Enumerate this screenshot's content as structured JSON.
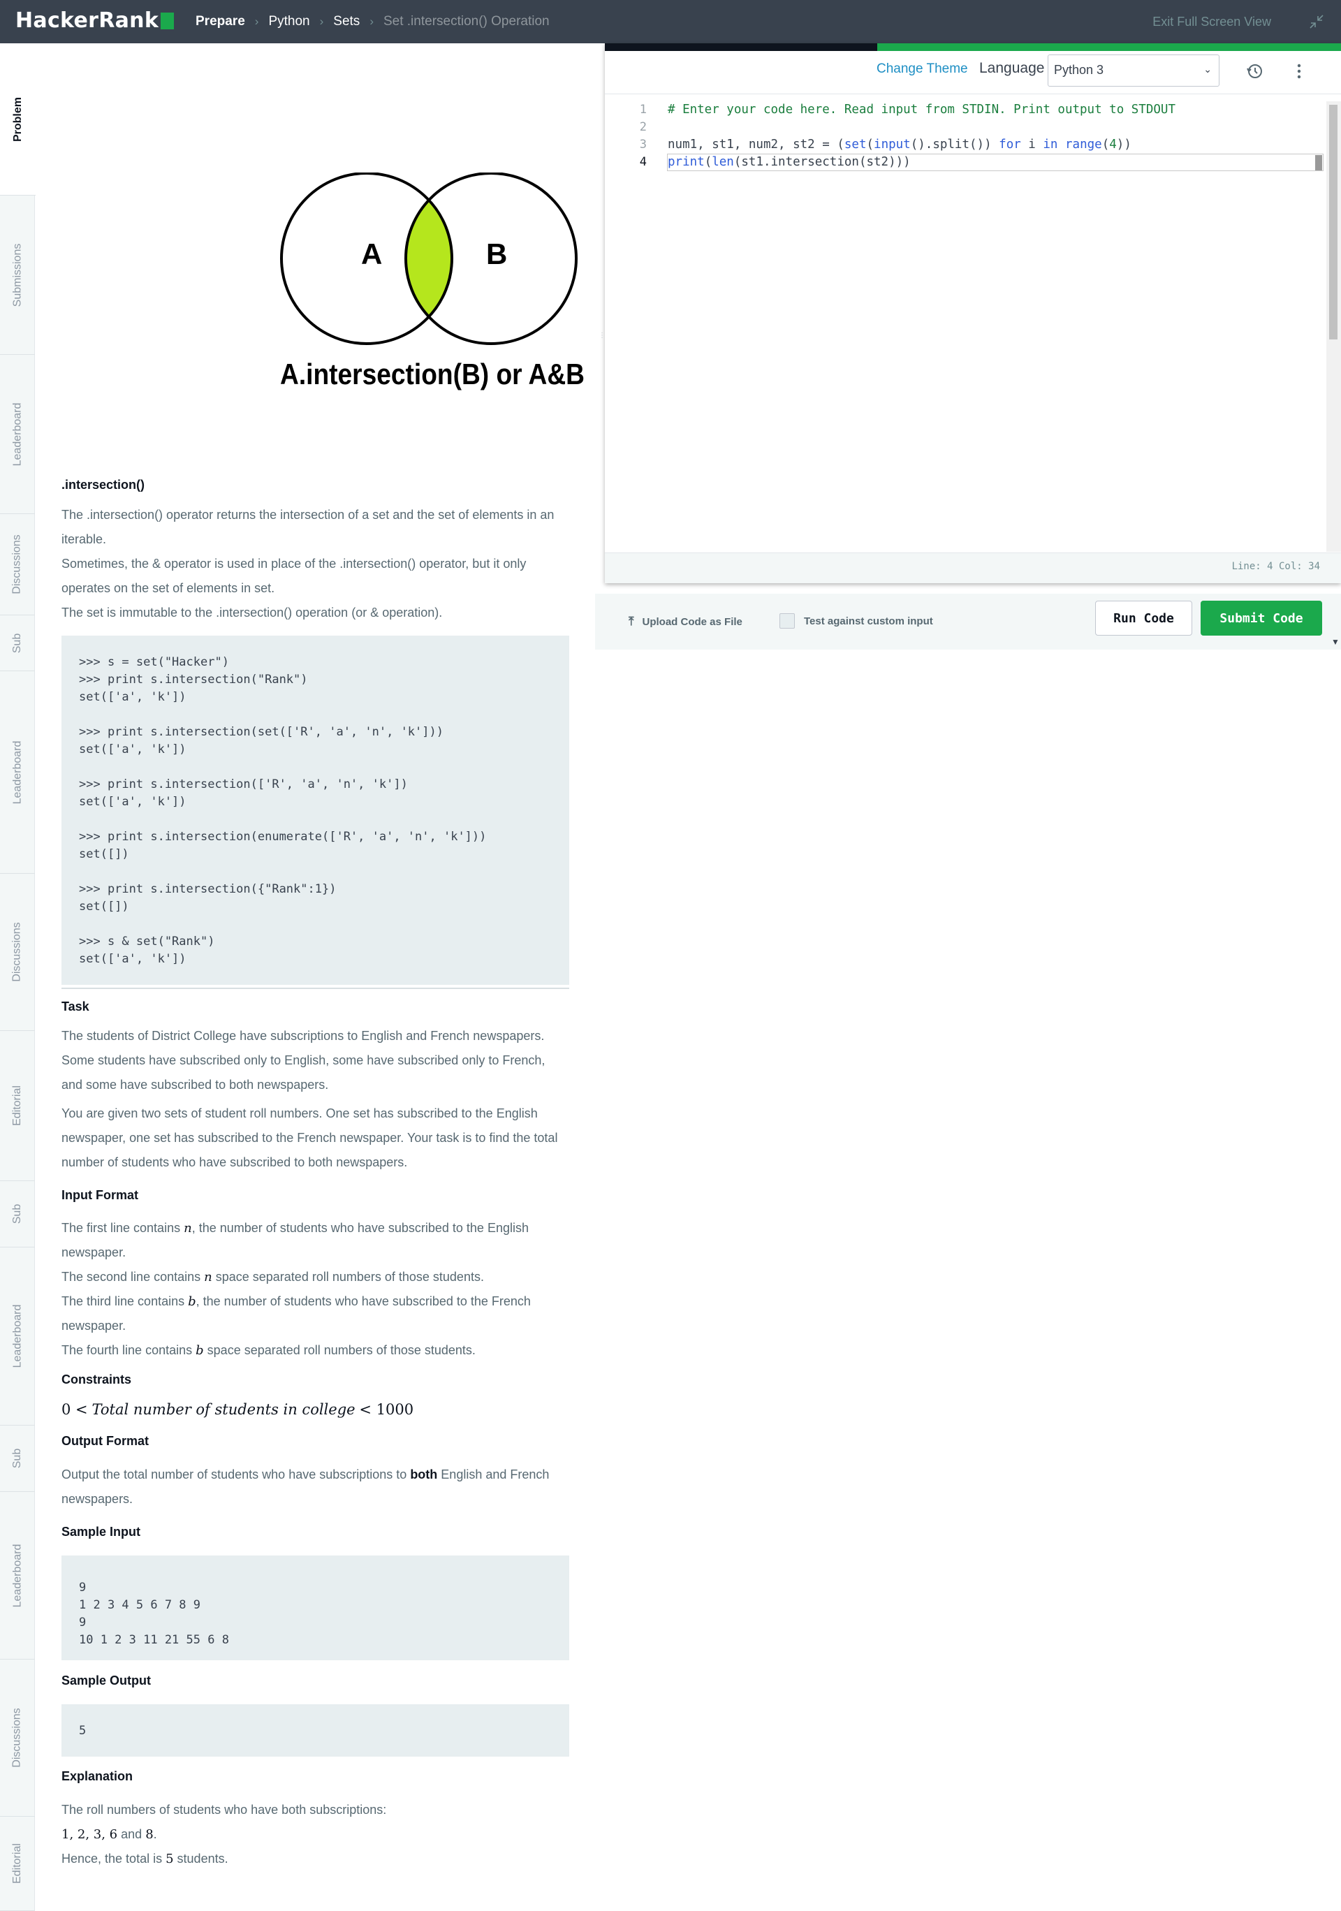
{
  "header": {
    "logo_text": "HackerRank",
    "breadcrumbs": [
      "Prepare",
      "Python",
      "Sets",
      "Set .intersection() Operation"
    ],
    "exit_fullscreen": "Exit Full Screen View"
  },
  "sidebar_tabs": [
    {
      "label": "Problem",
      "active": true
    },
    {
      "label": "Submissions"
    },
    {
      "label": "Leaderboard"
    },
    {
      "label": "Discussions"
    },
    {
      "label": "Sub"
    },
    {
      "label": "Leaderboard"
    },
    {
      "label": "Discussions"
    },
    {
      "label": "Editorial"
    },
    {
      "label": "Sub"
    },
    {
      "label": "Leaderboard"
    },
    {
      "label": "Sub"
    },
    {
      "label": "Leaderboard"
    },
    {
      "label": "Discussions"
    },
    {
      "label": "Editorial"
    }
  ],
  "venn": {
    "label_a": "A",
    "label_b": "B",
    "caption": "A.intersection(B) or A&B",
    "highlight_color": "#b5e61d"
  },
  "problem": {
    "section_title": ".intersection()",
    "intro_1": "The .intersection() operator returns the intersection of a set and the set of elements in an",
    "intro_1b": "iterable.",
    "intro_2": "Sometimes, the & operator is used in place of the .intersection() operator, but it only",
    "intro_2b": "operates on the set of elements in set.",
    "intro_3": "The set is immutable to the .intersection() operation (or & operation).",
    "example_code": ">>> s = set(\"Hacker\")\n>>> print s.intersection(\"Rank\")\nset(['a', 'k'])\n\n>>> print s.intersection(set(['R', 'a', 'n', 'k']))\nset(['a', 'k'])\n\n>>> print s.intersection(['R', 'a', 'n', 'k'])\nset(['a', 'k'])\n\n>>> print s.intersection(enumerate(['R', 'a', 'n', 'k']))\nset([])\n\n>>> print s.intersection({\"Rank\":1})\nset([])\n\n>>> s & set(\"Rank\")\nset(['a', 'k'])",
    "task_title": "Task",
    "task_1a": "The students of District College have subscriptions to English and French newspapers.",
    "task_1b": "Some students have subscribed only to English, some have subscribed only to French,",
    "task_1c": "and some have subscribed to both newspapers.",
    "task_2a": "You are given two sets of student roll numbers. One set has subscribed to the English",
    "task_2b": "newspaper, one set has subscribed to the French newspaper. Your task is to find the total",
    "task_2c": "number of students who have subscribed to both newspapers.",
    "input_title": "Input Format",
    "input_1a": "The first line contains",
    "input_1var": "n",
    "input_1b": ", the number of students who have subscribed to the English",
    "input_1c": "newspaper.",
    "input_2a": "The second line contains",
    "input_2var": "n",
    "input_2b": " space separated roll numbers of those students.",
    "input_3a": "The third line contains",
    "input_3var": "b",
    "input_3b": ", the number of students who have subscribed to the French",
    "input_3c": "newspaper.",
    "input_4a": "The fourth line contains",
    "input_4var": "b",
    "input_4b": " space separated roll numbers of those students.",
    "constraints_title": "Constraints",
    "constraint_lhs": "0 <",
    "constraint_mid": "Total number of students in college",
    "constraint_rhs": "< 1000",
    "output_title": "Output Format",
    "output_1a": "Output the total number of students who have subscriptions to",
    "output_bold": "both",
    "output_1b": " English and French",
    "output_1c": "newspapers.",
    "sample_input_title": "Sample Input",
    "sample_input": "9\n1 2 3 4 5 6 7 8 9\n9\n10 1 2 3 11 21 55 6 8",
    "sample_output_title": "Sample Output",
    "sample_output": "5",
    "explanation_title": "Explanation",
    "expl_1": "The roll numbers of students who have both subscriptions:",
    "expl_2_nums": "1, 2, 3, 6",
    "expl_2_and": " and ",
    "expl_2_last": "8",
    "expl_2_end": ".",
    "expl_3a": "Hence, the total is ",
    "expl_3_num": "5",
    "expl_3b": " students."
  },
  "editor": {
    "change_theme": "Change Theme",
    "language_label": "Language",
    "language_value": "Python 3",
    "line_numbers": [
      "1",
      "2",
      "3",
      "4"
    ],
    "status": "Line: 4 Col: 34",
    "progress_fraction": 0.37
  },
  "actions": {
    "upload_label": "Upload Code as File",
    "custom_input_label": "Test against custom input",
    "custom_input_checked": false,
    "run_label": "Run Code",
    "submit_label": "Submit Code"
  },
  "colors": {
    "header_bg": "#39424e",
    "accent_green": "#1ba94c",
    "link_blue": "#1f8fc4"
  }
}
